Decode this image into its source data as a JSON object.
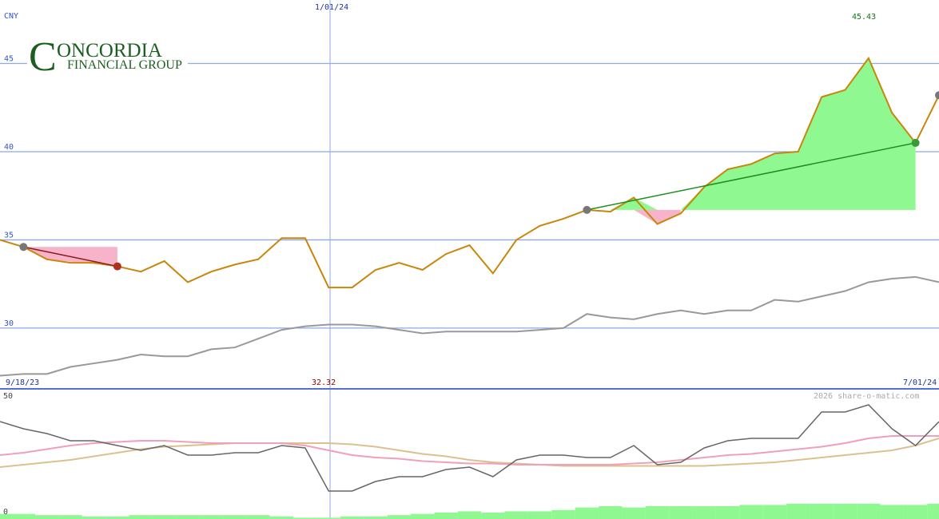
{
  "colors": {
    "price_line": "#c8860a",
    "moving_average": "#999999",
    "grid": "#8ea8e8",
    "axis_text": "#3355cc",
    "date_text": "#223399",
    "min_text": "#8b0000",
    "max_text": "#117711",
    "up_fill": "#90f890",
    "down_fill": "#f7b3c9",
    "up_trend": "#1e8f1e",
    "down_trend": "#8b1a1a",
    "oscillator": "#666666",
    "osc_pink": "#f0a0b8",
    "osc_tan": "#dcc090",
    "volume": "#90f890",
    "logo": "#1b5e20"
  },
  "logo": {
    "line1": "CONCORDIA",
    "line2": "FINANCIAL GROUP"
  },
  "labels": {
    "currency": "CNY",
    "date_mid": "1/01/24",
    "date_start": "9/18/23",
    "date_end": "7/01/24",
    "min_value": "32.32",
    "max_value": "45.43",
    "watermark": "2026 share-o-matic.com",
    "osc_top": "50",
    "osc_bottom": "0"
  },
  "chart_data": [
    {
      "type": "line",
      "yticks": [
        30,
        35,
        40,
        45
      ],
      "ylim": [
        26.6,
        48.6
      ],
      "series": [
        {
          "values": [
            35.0,
            34.6,
            33.9,
            33.7,
            33.7,
            33.5,
            33.2,
            33.8,
            32.6,
            33.2,
            33.6,
            33.9,
            35.1,
            35.1,
            32.3,
            32.3,
            33.3,
            33.7,
            33.3,
            34.2,
            34.7,
            33.1,
            35.0,
            35.8,
            36.2,
            36.7,
            36.6,
            37.4,
            35.9,
            36.5,
            38.0,
            39.0,
            39.3,
            39.9,
            40.0,
            43.1,
            43.5,
            45.3,
            42.2,
            40.5,
            43.2
          ]
        },
        {
          "values": [
            27.3,
            27.4,
            27.4,
            27.8,
            28.0,
            28.2,
            28.5,
            28.4,
            28.4,
            28.8,
            28.9,
            29.4,
            29.9,
            30.1,
            30.2,
            30.2,
            30.1,
            29.9,
            29.7,
            29.8,
            29.8,
            29.8,
            29.8,
            29.9,
            30.0,
            30.8,
            30.6,
            30.5,
            30.8,
            31.0,
            30.8,
            31.0,
            31.0,
            31.6,
            31.5,
            31.8,
            32.1,
            32.6,
            32.8,
            32.9,
            32.6
          ]
        }
      ],
      "down_trend": {
        "from_index": 1,
        "to_index": 5,
        "from_value": 34.6,
        "to_value": 33.5
      },
      "up_trend": {
        "from_index": 25,
        "to_index": 39,
        "from_value": 36.7,
        "to_value": 40.5
      }
    },
    {
      "type": "line",
      "ylim": [
        0,
        50
      ],
      "series": [
        {
          "values": [
            39,
            36,
            34,
            31,
            31,
            29,
            27,
            29,
            25,
            25,
            26,
            26,
            29,
            28,
            10,
            10,
            14,
            16,
            16,
            19,
            20,
            16,
            23,
            25,
            25,
            24,
            24,
            29,
            21,
            22,
            28,
            31,
            32,
            32,
            32,
            43,
            43,
            46,
            36,
            29,
            39
          ]
        },
        {
          "values": [
            25,
            26,
            27.5,
            29,
            30,
            30.5,
            31,
            31,
            30.5,
            30,
            30,
            30,
            30,
            29,
            27,
            25,
            24,
            23.5,
            22.5,
            22,
            21.5,
            21.5,
            21,
            21,
            21,
            21,
            21,
            21.5,
            22,
            23,
            24,
            25,
            25.5,
            26.5,
            27.5,
            28.5,
            30,
            32,
            33,
            33,
            33
          ]
        },
        {
          "values": [
            20,
            21,
            22,
            23,
            24.5,
            26,
            27.5,
            28.5,
            29,
            29.5,
            30,
            30,
            30,
            30,
            30,
            29.5,
            28.5,
            27,
            25.5,
            24.5,
            23,
            22,
            21.5,
            21,
            20.5,
            20.5,
            20.5,
            20.5,
            20.5,
            20.5,
            20.5,
            21,
            21.5,
            22,
            23,
            24,
            25,
            26,
            27,
            29,
            32
          ]
        }
      ]
    },
    {
      "type": "bar",
      "values": [
        4,
        4,
        3,
        3,
        2,
        2,
        3,
        3,
        3,
        3,
        3,
        3,
        2,
        1,
        1,
        2,
        2,
        3,
        4,
        5,
        6,
        5,
        6,
        6,
        7,
        9,
        10,
        9,
        10,
        10,
        10,
        10,
        11,
        11,
        12,
        12,
        12,
        12,
        11,
        11,
        12
      ]
    }
  ]
}
